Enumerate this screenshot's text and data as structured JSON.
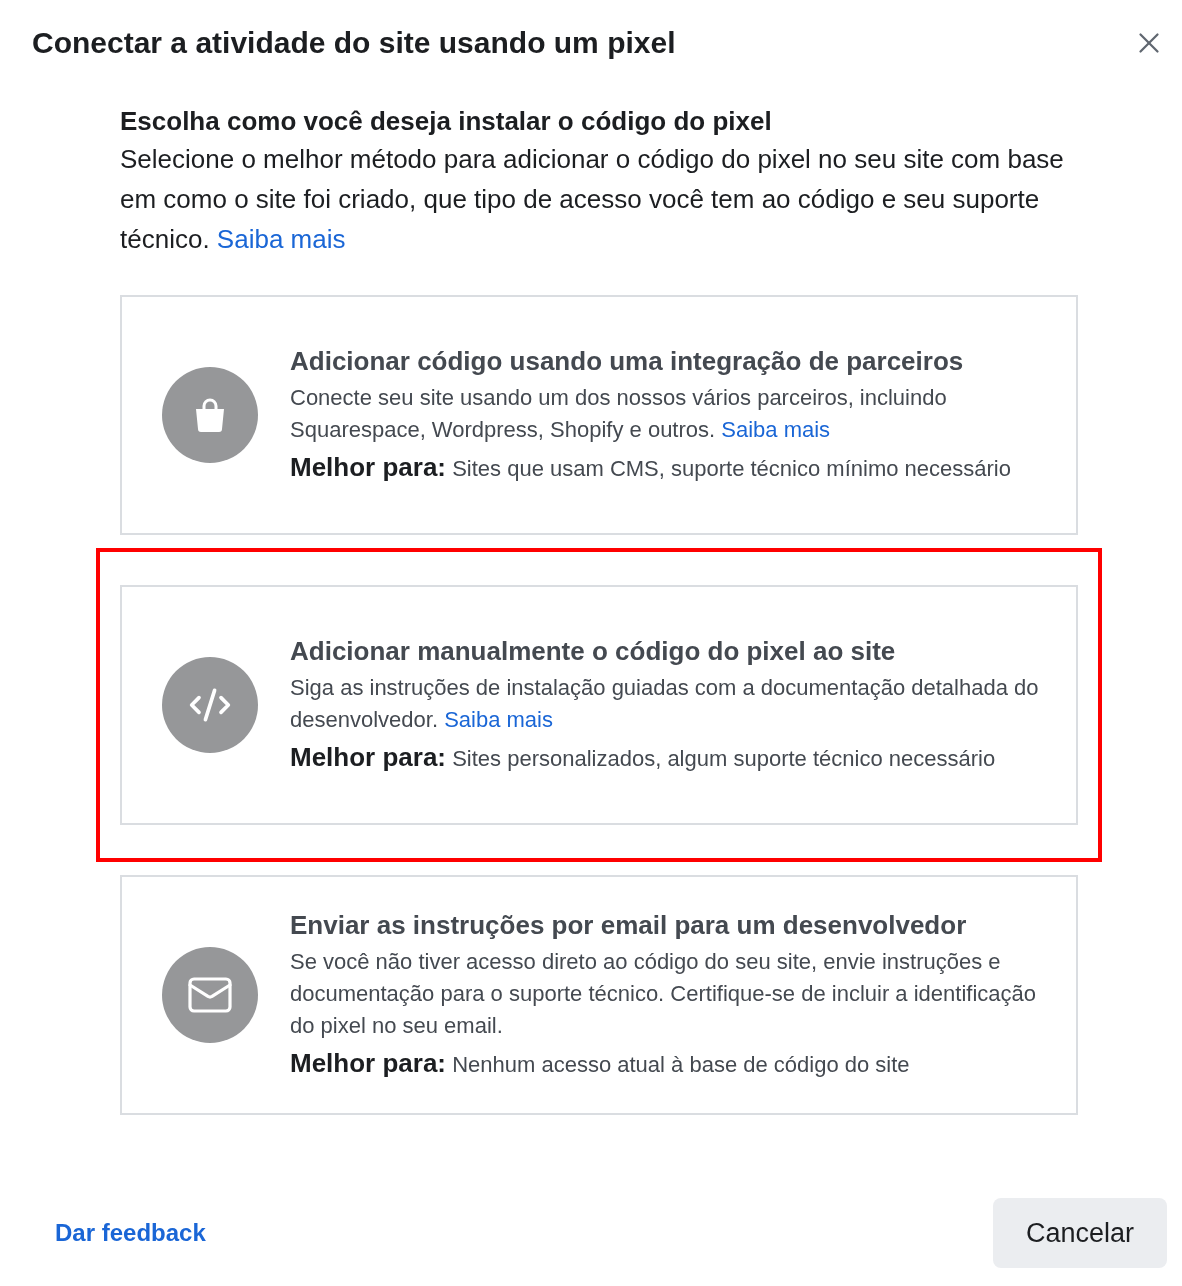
{
  "dialog": {
    "title": "Conectar a atividade do site usando um pixel"
  },
  "intro": {
    "heading": "Escolha como você deseja instalar o código do pixel",
    "text": "Selecione o melhor método para adicionar o código do pixel no seu site com base em como o site foi criado, que tipo de acesso você tem ao código e seu suporte técnico.",
    "link": "Saiba mais"
  },
  "options": [
    {
      "kind": "partner",
      "highlighted": false,
      "title": "Adicionar código usando uma integração de parceiros",
      "text": "Conecte seu site usando um dos nossos vários parceiros, incluindo Squarespace, Wordpress, Shopify e outros.",
      "link": "Saiba mais",
      "best_for_label": "Melhor para:",
      "best_for": "Sites que usam CMS, suporte técnico mínimo necessário"
    },
    {
      "kind": "code",
      "highlighted": true,
      "title": "Adicionar manualmente o código do pixel ao site",
      "text": "Siga as instruções de instalação guiadas com a documentação detalhada do desenvolvedor.",
      "link": "Saiba mais",
      "best_for_label": "Melhor para:",
      "best_for": "Sites personalizados, algum suporte técnico necessário"
    },
    {
      "kind": "email",
      "highlighted": false,
      "title": "Enviar as instruções por email para um desenvolvedor",
      "text": "Se você não tiver acesso direto ao código do seu site, envie instruções e documentação para o suporte técnico. Certifique-se de incluir a identificação do pixel no seu email.",
      "best_for_label": "Melhor para:",
      "best_for": "Nenhum acesso atual à base de código do site"
    }
  ],
  "footer": {
    "feedback_link": "Dar feedback",
    "cancel_button": "Cancelar"
  }
}
